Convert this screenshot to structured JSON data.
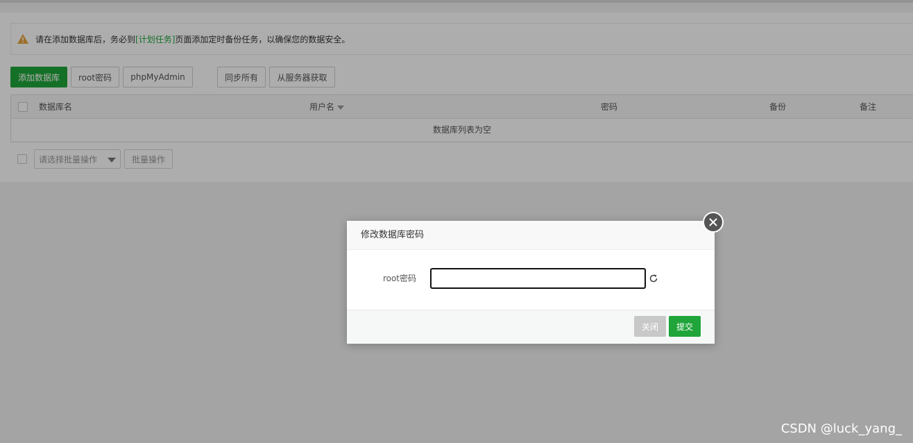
{
  "notice": {
    "text_before": "请在添加数据库后，务必到",
    "link": "[计划任务]",
    "text_after": "页面添加定时备份任务，以确保您的数据安全。"
  },
  "toolbar": {
    "add_db": "添加数据库",
    "root_password": "root密码",
    "phpmyadmin": "phpMyAdmin",
    "sync_all": "同步所有",
    "fetch_from_server": "从服务器获取"
  },
  "table": {
    "columns": [
      "数据库名",
      "用户名",
      "密码",
      "备份",
      "备注"
    ],
    "empty_text": "数据库列表为空"
  },
  "batch": {
    "select_placeholder": "请选择批量操作",
    "button": "批量操作"
  },
  "dialog": {
    "title": "修改数据库密码",
    "field_label": "root密码",
    "input_value": "",
    "close_button": "关闭",
    "submit_button": "提交"
  },
  "colors": {
    "accent": "#20a53a",
    "warning": "#e6a23c"
  },
  "watermark": "CSDN @luck_yang_"
}
